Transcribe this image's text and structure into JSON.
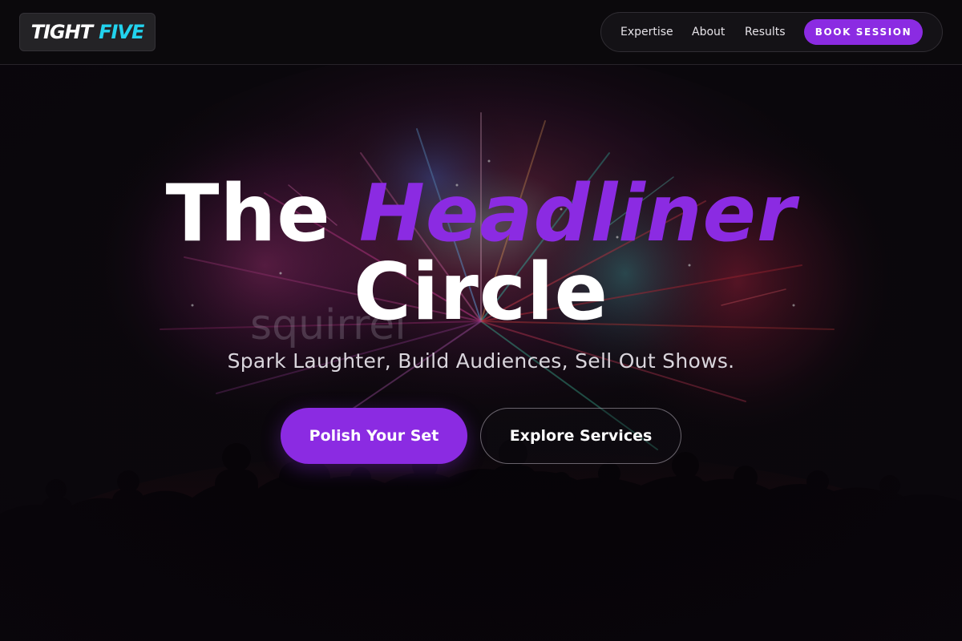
{
  "header": {
    "logo": {
      "word1": "TIGHT",
      "word2": "FIVE"
    },
    "nav": {
      "links": [
        "Expertise",
        "About",
        "Results"
      ],
      "cta_label": "BOOK SESSION"
    }
  },
  "hero": {
    "title": {
      "word1": "The",
      "accent_word": "Headliner",
      "line2": "Circle"
    },
    "watermark_text": "squirrel",
    "subtitle": "Spark Laughter, Build Audiences, Sell Out Shows.",
    "primary_button": "Polish Your Set",
    "secondary_button": "Explore Services",
    "background_image": "fireworks-crowd-photo"
  },
  "colors": {
    "accent_purple": "#8b2be2",
    "logo_cyan": "#22d3ee",
    "background": "#0b080c",
    "text_white": "#ffffff"
  }
}
